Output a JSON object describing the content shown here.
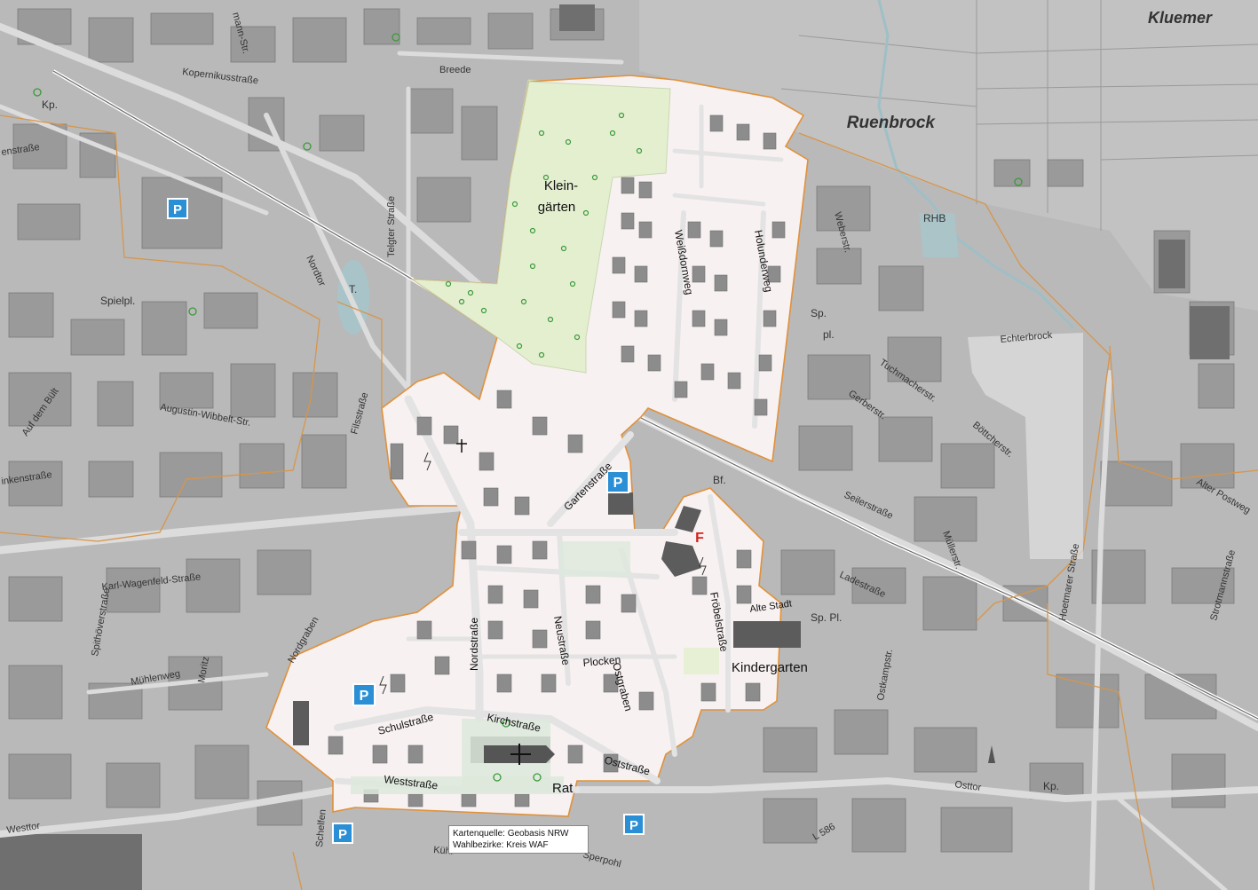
{
  "colors": {
    "background": "#b9b9b9",
    "road": "#e8e8e8",
    "district_fill": "#f7f0f0",
    "district_border": "#e0913a",
    "garden": "#e4efd0",
    "green_area": "#dde9dc",
    "building_gray": "#8e8e8e",
    "building_dark": "#5c5c5c",
    "parking_blue": "#2b8fd6",
    "fire_red": "#d2231d",
    "water": "#a9c4c9"
  },
  "labels": {
    "kluemer": "Kluemer",
    "ruenbrock": "Ruenbrock",
    "kleingarten_1": "Klein-",
    "kleingarten_2": "gärten",
    "kindergarten": "Kindergarten",
    "rat": "Rat",
    "fire_station": "F",
    "parking": "P",
    "rhb": "RHB",
    "t": "T.",
    "bf": "Bf.",
    "kp1": "Kp.",
    "kp2": "Kp.",
    "sp": "Sp.",
    "pl": "pl.",
    "sp_pl": "Sp. Pl.",
    "spielpl": "Spielpl."
  },
  "streets": [
    "Breede",
    "Kopernikusstraße",
    "Telgter Straße",
    "Nordtor",
    "Auf dem Bült",
    "Augustin-Wibbelt-Str.",
    "Filsstraße",
    "Karl-Wagenfeld-Straße",
    "Spithöverstraße",
    "Mühlenweg",
    "Moritz",
    "Nordgraben",
    "Schulstraße",
    "Weststraße",
    "Kirchstraße",
    "Oststraße",
    "Nordstraße",
    "Neustraße",
    "Plocken",
    "Ostgraben",
    "Fröbelstraße",
    "Alte Stadt",
    "Gartenstraße",
    "Weißdornweg",
    "Holunderweg",
    "Weberstr.",
    "Tuchmacherstr.",
    "Gerberstr.",
    "Böttcherstr.",
    "Seilerstraße",
    "Müllerstr.",
    "Alter Postweg",
    "Ladestraße",
    "Hoetmarer Straße",
    "Ostkampstr.",
    "Osttor",
    "Westtor",
    "Schelfen",
    "Kühl",
    "Sperpohl",
    "L 586",
    "Echterbrock",
    "Strotmannstraße",
    "inkenstraße",
    "enstraße",
    "mann-Str."
  ],
  "credit": {
    "line1": "Kartenquelle: Geobasis NRW",
    "line2": "Wahlbezirke: Kreis WAF"
  },
  "icons": {
    "parking": "parking-sign-icon",
    "tree": "tree-icon",
    "church": "church-icon",
    "cross": "cross-icon",
    "power": "power-station-icon",
    "monument": "monument-icon",
    "playground": "playground-icon"
  }
}
